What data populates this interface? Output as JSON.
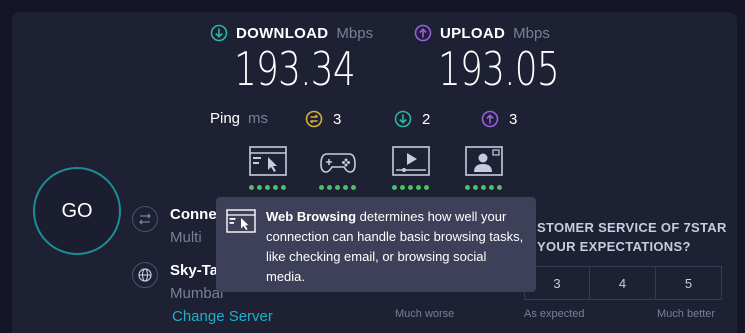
{
  "download": {
    "label": "DOWNLOAD",
    "unit": "Mbps",
    "value": "193.34"
  },
  "upload": {
    "label": "UPLOAD",
    "unit": "Mbps",
    "value": "193.05"
  },
  "ping": {
    "label": "Ping",
    "unit": "ms",
    "idle": "3",
    "download": "2",
    "upload": "3"
  },
  "use_cases": [
    {
      "name": "Web Browsing",
      "icon": "web-browsing-icon",
      "rating": 5
    },
    {
      "name": "Gaming",
      "icon": "gamepad-icon",
      "rating": 5
    },
    {
      "name": "Video Streaming",
      "icon": "video-icon",
      "rating": 5
    },
    {
      "name": "Video Chat",
      "icon": "video-chat-icon",
      "rating": 5
    }
  ],
  "go_label": "GO",
  "connections": {
    "title": "Conne",
    "sub": "Multi"
  },
  "server": {
    "title": "Sky-Ta",
    "sub": "Mumbai",
    "change_label": "Change Server"
  },
  "survey": {
    "line1": "STOMER SERVICE OF 7STAR",
    "line2": "YOUR EXPECTATIONS?",
    "options": [
      "3",
      "4",
      "5"
    ],
    "labels": {
      "worse": "Much worse",
      "expected": "As expected",
      "better": "Much better"
    }
  },
  "tooltip": {
    "title": "Web Browsing",
    "text": " determines how well your connection can handle basic browsing tasks, like checking email, or browsing social media."
  },
  "colors": {
    "accent_teal": "#1eb0c8",
    "download_icon": "#2bb5a5",
    "upload_icon": "#9b5de5",
    "ping_icon": "#d9b234",
    "rating_dot": "#4cbf61"
  }
}
